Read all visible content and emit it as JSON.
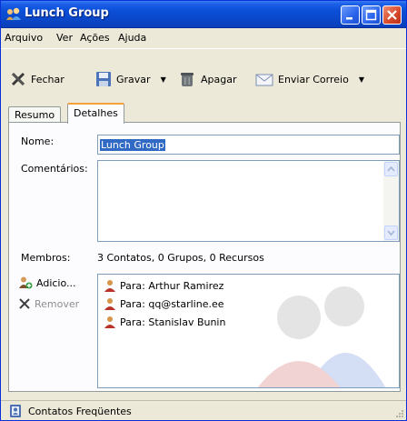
{
  "window": {
    "title": "Lunch Group"
  },
  "menu": {
    "items": [
      "Arquivo",
      "Ver",
      "Ações",
      "Ajuda"
    ]
  },
  "toolbar": {
    "close_label": "Fechar",
    "save_label": "Gravar",
    "delete_label": "Apagar",
    "send_label": "Enviar Correio"
  },
  "tabs": [
    "Resumo",
    "Detalhes"
  ],
  "details": {
    "name_label": "Nome:",
    "name_value": "Lunch Group",
    "comments_label": "Comentários:",
    "members_label": "Membros:",
    "members_summary": "3 Contatos, 0 Grupos, 0 Recursos",
    "add_label": "Adicio...",
    "remove_label": "Remover",
    "members": [
      "Para: Arthur Ramirez",
      "Para: qq@starline.ee",
      "Para: Stanislav Bunin"
    ]
  },
  "status": {
    "text": "Contatos Freqüentes"
  },
  "colors": {
    "titlebar": "#0a4ed6",
    "selection": "#316ac5",
    "active_tab_accent": "#f5a23a"
  },
  "icons": [
    "group-icon",
    "close-x-icon",
    "save-icon",
    "delete-icon",
    "mail-icon",
    "add-contact-icon",
    "remove-x-icon",
    "contact-icon",
    "contacts-book-icon"
  ]
}
